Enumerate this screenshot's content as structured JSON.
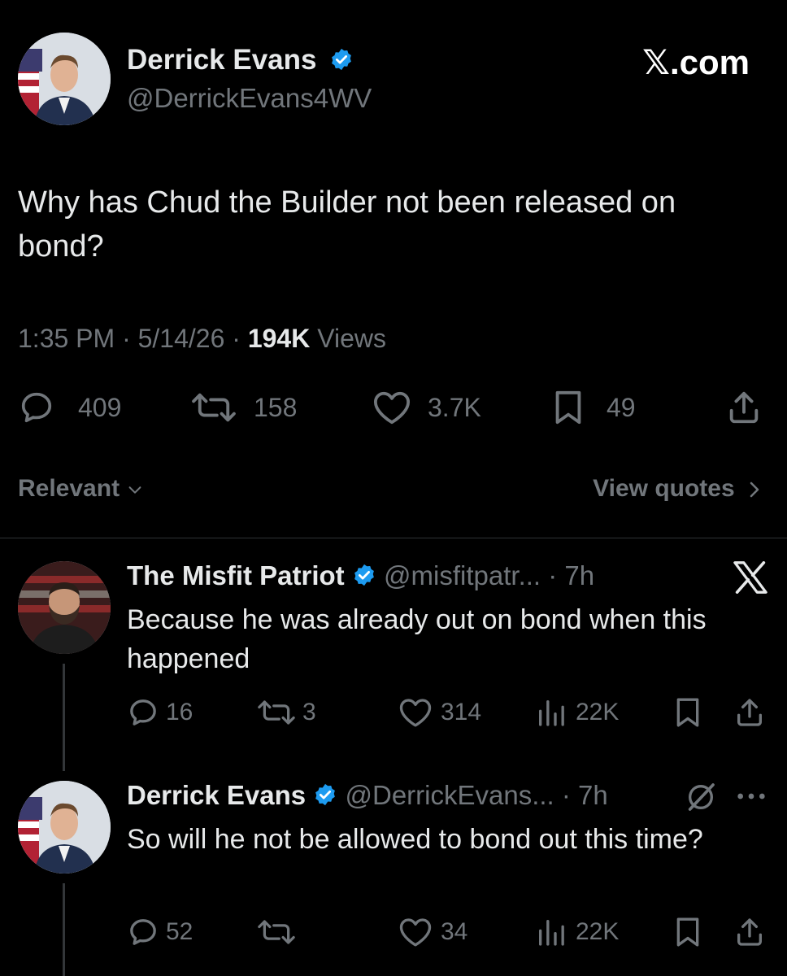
{
  "main_post": {
    "author": {
      "name": "Derrick Evans",
      "handle": "@DerrickEvans4WV",
      "verified": true
    },
    "brand": "𝕏.com",
    "text": "Why has Chud the Builder not been released on bond?",
    "meta": {
      "time": "1:35 PM",
      "sep1": "·",
      "date": "5/14/26",
      "sep2": "·",
      "views_count": "194K",
      "views_label": " Views"
    },
    "actions": {
      "replies": "409",
      "reposts": "158",
      "likes": "3.7K",
      "bookmarks": "49"
    }
  },
  "sort_bar": {
    "sort_label": "Relevant",
    "view_quotes": "View quotes"
  },
  "replies": [
    {
      "name": "The Misfit Patriot",
      "handle": "@misfitpatr...",
      "time": "· 7h",
      "verified": true,
      "text": "Because he was already out on bond when this happened",
      "actions": {
        "replies": "16",
        "reposts": "3",
        "likes": "314",
        "views": "22K"
      }
    },
    {
      "name": "Derrick Evans",
      "handle": "@DerrickEvans...",
      "time": "· 7h",
      "verified": true,
      "text": "So will he not be allowed to bond out this time?",
      "actions": {
        "replies": "52",
        "reposts": "",
        "likes": "34",
        "views": "22K"
      }
    }
  ],
  "icons": {
    "reply": "speech-bubble-icon",
    "repost": "repost-arrows-icon",
    "like": "heart-icon",
    "bookmark": "bookmark-icon",
    "share": "share-icon",
    "views": "bar-chart-icon",
    "verified": "verified-badge-icon",
    "x_logo": "x-logo-icon",
    "grok": "grok-icon",
    "more": "more-dots-icon"
  },
  "colors": {
    "background": "#000000",
    "text": "#e7e9ea",
    "muted": "#71767b",
    "verified_blue": "#1d9bf0"
  }
}
